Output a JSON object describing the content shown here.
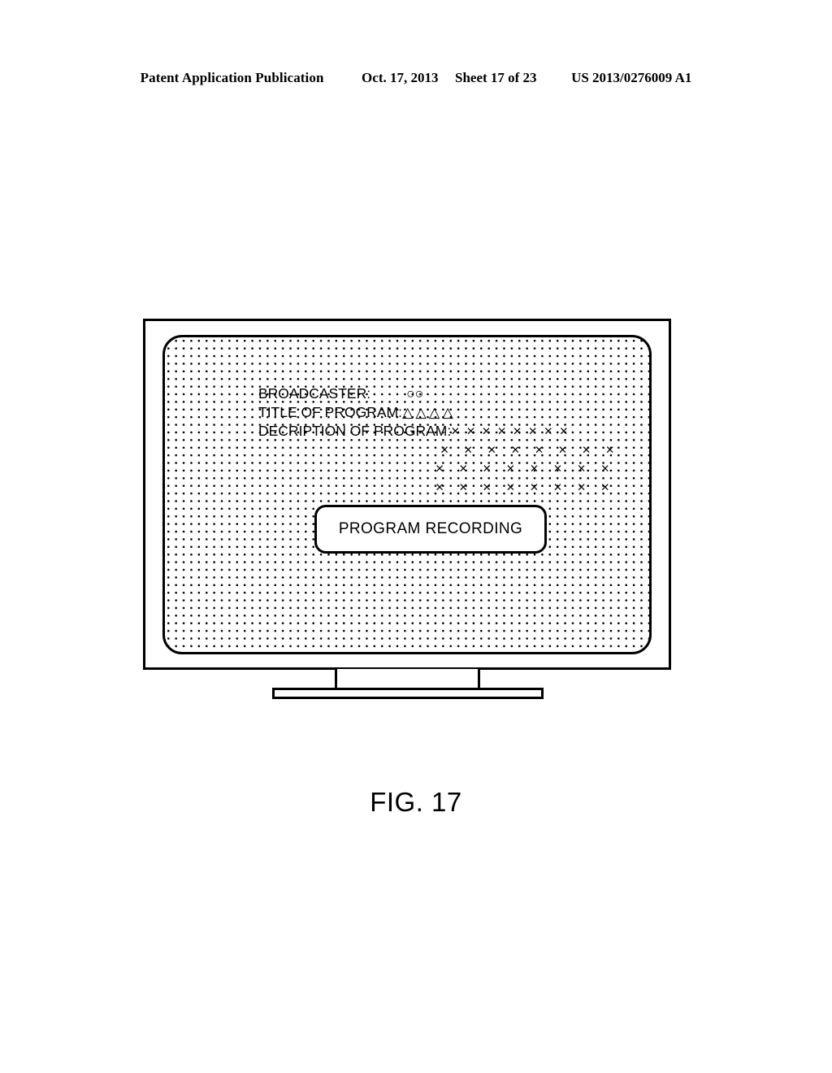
{
  "header": {
    "publication": "Patent Application Publication",
    "date": "Oct. 17, 2013",
    "sheet": "Sheet 17 of 23",
    "patent_number": "US 2013/0276009 A1"
  },
  "figure": {
    "caption": "FIG. 17"
  },
  "tv": {
    "screen": {
      "info": {
        "broadcaster_label": "BROADCASTER:",
        "broadcaster_value": "○○",
        "title_label": "TITLE OF PROGRAM:",
        "title_value": "△△△△",
        "description_label": "DECRIPTION OF PROGRAM:",
        "description_rows": [
          "× × × × × × × ×",
          "× × × × × × × ×",
          "× × × × × × × ×",
          "× × × × × × × ×"
        ]
      },
      "button_label": "PROGRAM RECORDING"
    }
  },
  "colors": {
    "ink": "#000000",
    "paper": "#ffffff"
  }
}
